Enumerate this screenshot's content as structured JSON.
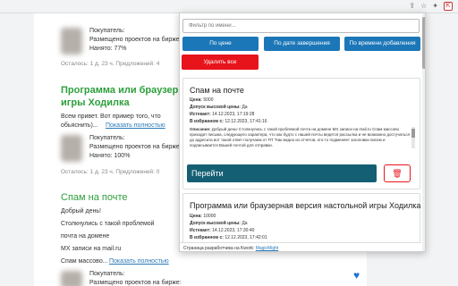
{
  "background": {
    "card1": {
      "buyer_label": "Покупатель:",
      "projects_placed": "Размещено проектов на бирже:",
      "hired": "Нанято: 77%",
      "meta": "Осталось: 1 д. 23 ч.  Предложений: 4"
    },
    "card2": {
      "title_line1": "Программа или браузерная в",
      "title_line2": "игры Ходилка",
      "desc_line1": "Всем привет. Вот пример того, что",
      "desc_line2": "обьяснить)...",
      "more_link": "Показать полностью",
      "buyer_label": "Покупатель:",
      "projects_placed": "Размещено проектов на бирже:",
      "hired": "Нанято: 100%",
      "meta": "Осталось: 1 д. 23 ч.  Предложений: 0"
    },
    "card3": {
      "title": "Спам на почте",
      "line1": "Добрый день!",
      "line2": "Столкнулись с такой проблемой",
      "line3": "почта на домене",
      "line4": "MX записи на mail.ru",
      "line5": "Спам массово...",
      "more_link": "Показать полностью",
      "buyer_label": "Покупатель:",
      "projects_placed": "Размещено проектов на бирже:"
    },
    "heart_icon": "heart-icon",
    "accent_green": "#2c9f3b"
  },
  "popup": {
    "filter_placeholder": "Фильтр по имени...",
    "sort_by_price": "По цене",
    "sort_by_end_date": "По дате завершения",
    "sort_by_added_time": "По времени добавления",
    "delete_all": "Удалить все",
    "cards": [
      {
        "title": "Спам на почте",
        "price_label": "Цена:",
        "price_value": "5000",
        "hvt_label": "Допуск высокой цены:",
        "hvt_value": "Да",
        "expires_label": "Истекает:",
        "expires_value": "14.12.2023, 17:19:28",
        "fav_label": "В избранном с:",
        "fav_value": "12.12.2023, 17:41:16",
        "desc_label": "Описание:",
        "desc_text": "Добрый день! Столкнулись с такой проблемой почта на домене MX записи на mail.ru Спам массово приходит письма, следующего характера, что как будто с нашей почты ведется рассылка и не возможно достучаться до адресата вот такой ответ получаем от ТП \"Как видно из отчетов, кто-то подменяет заголовки писем и подписывается Вашей почтой для отправки.",
        "go_button": "Перейти"
      },
      {
        "title": "Программа или браузерная версия настольной игры Ходилка",
        "price_label": "Цена:",
        "price_value": "10000",
        "hvt_label": "Допуск высокой цены:",
        "hvt_value": "Да",
        "expires_label": "Истекает:",
        "expires_value": "14.12.2023, 17:30:40",
        "fav_label": "В избранном с:",
        "fav_value": "12.12.2023, 17:42:01"
      }
    ],
    "footer_text": "Страница разработчика на Kwork:",
    "footer_link": "MagicMight",
    "colors": {
      "sort_blue": "#1c77b8",
      "delete_red": "#e8141b",
      "go_teal": "#155f74"
    }
  }
}
